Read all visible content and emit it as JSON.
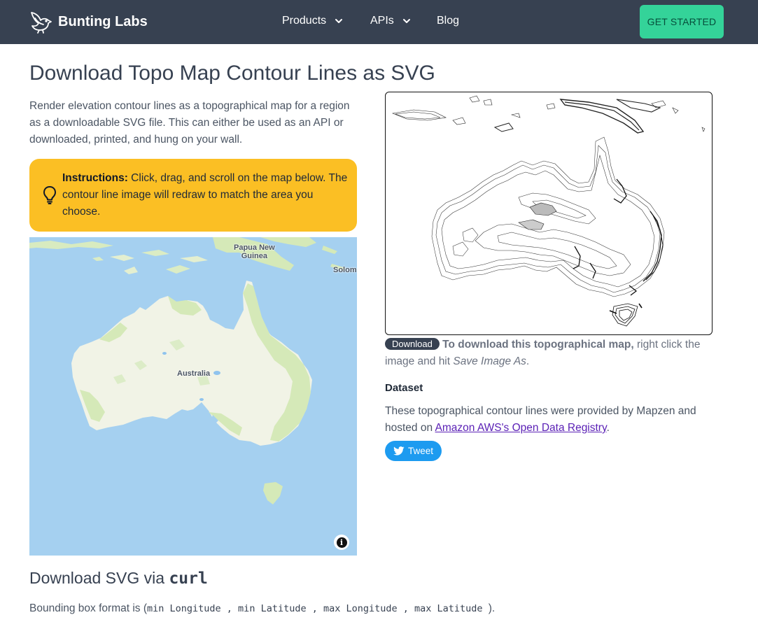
{
  "nav": {
    "brand": "Bunting Labs",
    "links": [
      {
        "label": "Products",
        "icon": "chevron-down-icon"
      },
      {
        "label": "APIs",
        "icon": "chevron-down-icon"
      },
      {
        "label": "Blog"
      }
    ],
    "cta": "GET STARTED"
  },
  "page": {
    "title": "Download Topo Map Contour Lines as SVG",
    "intro": "Render elevation contour lines as a topographical map for a region as a downloadable SVG file. This can either be used as an API or downloaded, printed, and hung on your wall."
  },
  "instructions": {
    "icon": "lightbulb-icon",
    "label": "Instructions:",
    "text": " Click, drag, and scroll on the map below. The contour line image will redraw to match the area you choose."
  },
  "map": {
    "labels": {
      "png": "Papua New\nGuinea",
      "australia": "Australia",
      "solomon": "Solom"
    },
    "info_icon": "info-icon",
    "colors": {
      "water": "#a5d0f0",
      "land": "#f1f3e6",
      "vegetation": "#d5e9b8",
      "lakes": "#8fc3ee"
    }
  },
  "download": {
    "badge": "Download",
    "bold": "To download this topographical map,",
    "text_before_em": " right click the image and hit ",
    "em": "Save Image As",
    "text_after": "."
  },
  "dataset": {
    "heading": "Dataset",
    "text": "These topographical contour lines were provided by Mapzen and hosted on ",
    "link": "Amazon AWS's Open Data Registry",
    "text_end": "."
  },
  "tweet": {
    "label": "Tweet",
    "icon": "twitter-bird-icon"
  },
  "curl": {
    "heading_prefix": "Download SVG via ",
    "heading_code": "curl",
    "bbox_prefix": "Bounding box format is (",
    "bbox_code": "min Longitude , min Latitude , max Longitude , max Latitude ",
    "bbox_suffix": ")."
  },
  "colors": {
    "nav_bg": "#374151",
    "cta_bg": "#34d399",
    "callout_bg": "#fbbf24",
    "tweet_bg": "#1d9bf0",
    "link": "#5b21b6"
  }
}
